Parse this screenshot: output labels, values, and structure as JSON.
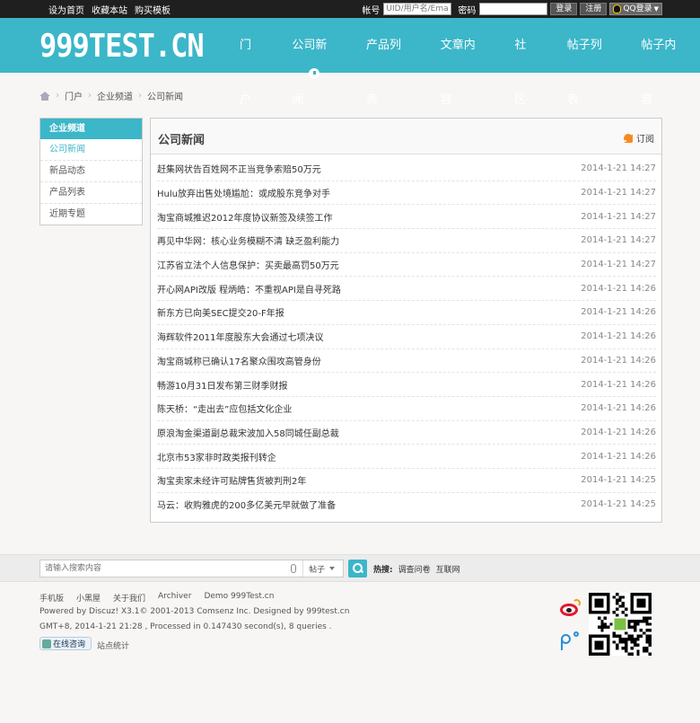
{
  "topbar": {
    "links": [
      "设为首页",
      "收藏本站",
      "购买模板"
    ],
    "account_label": "帐号",
    "account_placeholder": "UID/用户名/Email",
    "password_label": "密码",
    "login_button": "登录",
    "register_button": "注册",
    "qq_login": "QQ登录"
  },
  "header": {
    "logo": "999TEST.CN",
    "nav": [
      "门户",
      "公司新闻",
      "产品列表",
      "文章内容",
      "社区",
      "帖子列表",
      "帖子内容"
    ],
    "active_nav": "公司新闻"
  },
  "breadcrumb": [
    "门户",
    "企业频道",
    "公司新闻"
  ],
  "sidebar": {
    "heading": "企业频道",
    "items": [
      "公司新闻",
      "新品动态",
      "产品列表",
      "近期专题"
    ],
    "current": "公司新闻"
  },
  "panel": {
    "title": "公司新闻",
    "subscribe": "订阅",
    "articles": [
      {
        "title": "赶集网状告百姓网不正当竞争索赔50万元",
        "date": "2014-1-21 14:27"
      },
      {
        "title": "Hulu放弃出售处境尴尬：或成股东竞争对手",
        "date": "2014-1-21 14:27"
      },
      {
        "title": "淘宝商城推迟2012年度协议新签及续签工作",
        "date": "2014-1-21 14:27"
      },
      {
        "title": "再见中华网：核心业务模糊不清 缺乏盈利能力",
        "date": "2014-1-21 14:27"
      },
      {
        "title": "江苏省立法个人信息保护：买卖最高罚50万元",
        "date": "2014-1-21 14:27"
      },
      {
        "title": "开心网API改版 程炳皓：不重视API是自寻死路",
        "date": "2014-1-21 14:26"
      },
      {
        "title": "新东方已向美SEC提交20-F年报",
        "date": "2014-1-21 14:26"
      },
      {
        "title": "海辉软件2011年度股东大会通过七项决议",
        "date": "2014-1-21 14:26"
      },
      {
        "title": "淘宝商城称已确认17名聚众围攻高管身份",
        "date": "2014-1-21 14:26"
      },
      {
        "title": "畅游10月31日发布第三财季财报",
        "date": "2014-1-21 14:26"
      },
      {
        "title": "陈天桥：“走出去”应包括文化企业",
        "date": "2014-1-21 14:26"
      },
      {
        "title": "原浪淘金渠道副总裁宋波加入58同城任副总裁",
        "date": "2014-1-21 14:26"
      },
      {
        "title": "北京市53家非时政类报刊转企",
        "date": "2014-1-21 14:26"
      },
      {
        "title": "淘宝卖家未经许可贴牌售货被判刑2年",
        "date": "2014-1-21 14:25"
      },
      {
        "title": "马云：收购雅虎的200多亿美元早就做了准备",
        "date": "2014-1-21 14:25"
      }
    ]
  },
  "search": {
    "placeholder": "请输入搜索内容",
    "scope": "帖子",
    "hot_label": "热搜:",
    "hot_items": [
      "调查问卷",
      "互联网"
    ]
  },
  "footer": {
    "links": [
      "手机版",
      "小黑屋",
      "关于我们",
      "Archiver",
      "Demo 999Test.cn"
    ],
    "powered": "Powered by Discuz! X3.1© 2001-2013 Comsenz Inc. Designed by 999test.cn",
    "stats": "GMT+8, 2014-1-21 21:28 , Processed in 0.147430 second(s), 8 queries .",
    "online_badge": "在线咨询",
    "site_stats": "站点统计"
  },
  "colors": {
    "brand": "#3cb6c9",
    "topbar": "#1f1f1f"
  }
}
